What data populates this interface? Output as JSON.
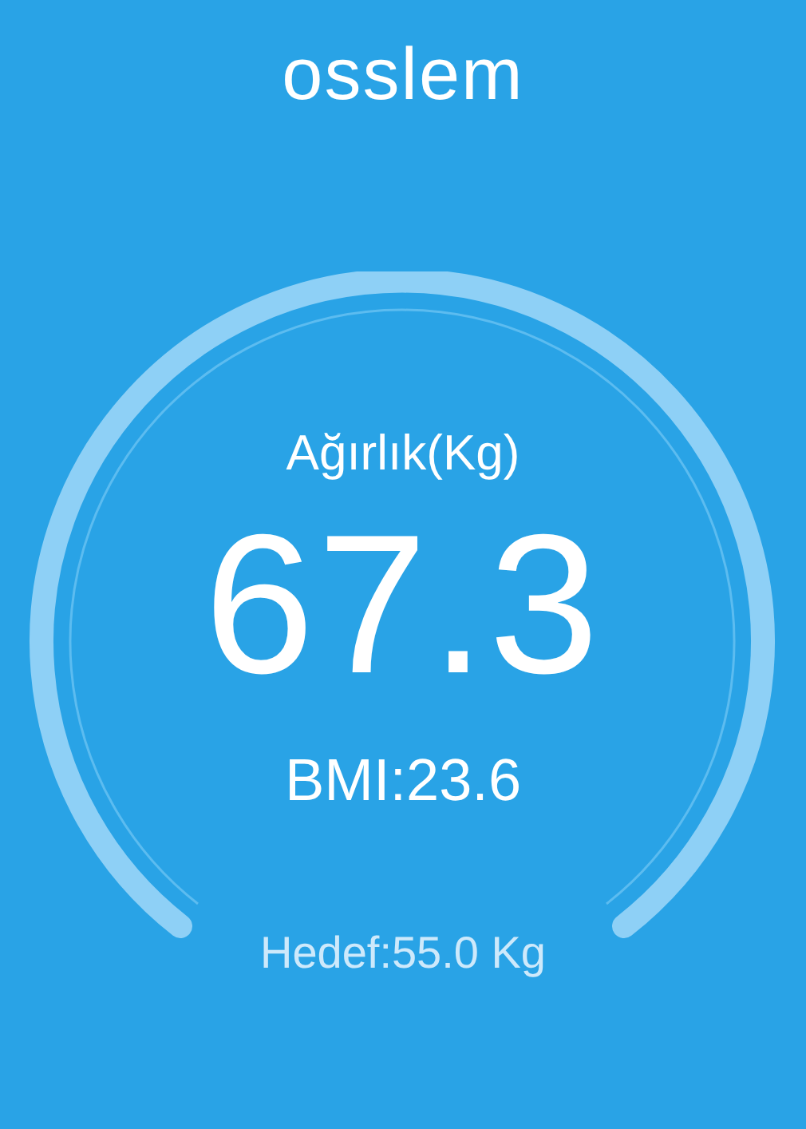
{
  "app": {
    "title": "osslem"
  },
  "gauge": {
    "label": "Ağırlık(Kg)",
    "value": "67.3",
    "bmi": "BMI:23.6"
  },
  "goal": {
    "text": "Hedef:55.0 Kg"
  }
}
